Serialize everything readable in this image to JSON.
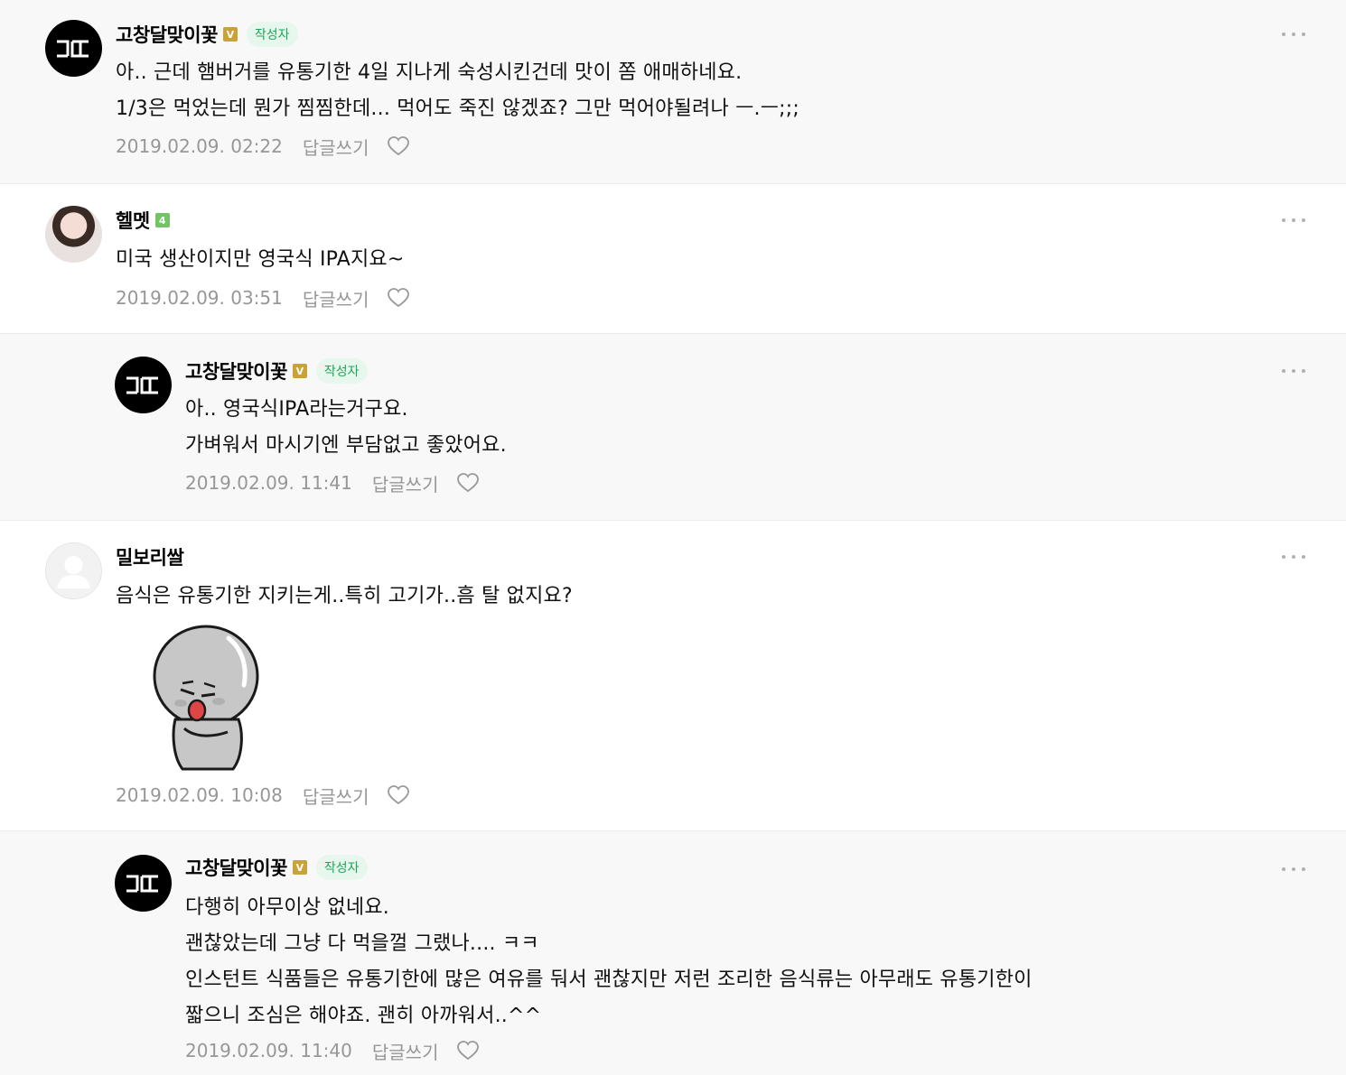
{
  "comments": [
    {
      "nickname": "고창달맞이꽃",
      "badge": "V",
      "author_tag": "작성자",
      "text": "아.. 근데 햄버거를 유통기한 4일 지나게 숙성시킨건데 맛이 쫌 애매하네요.\n1/3은 먹었는데 뭔가 찜찜한데... 먹어도 죽진 않겠죠? 그만 먹어야될려나 ㅡ.ㅡ;;;",
      "date": "2019.02.09. 02:22",
      "reply_label": "답글쓰기"
    },
    {
      "nickname": "헬멧",
      "badge": "4",
      "text": "미국 생산이지만 영국식 IPA지요~",
      "date": "2019.02.09. 03:51",
      "reply_label": "답글쓰기"
    },
    {
      "nickname": "고창달맞이꽃",
      "badge": "V",
      "author_tag": "작성자",
      "text": "아.. 영국식IPA라는거구요.\n가벼워서 마시기엔 부담없고 좋았어요.",
      "date": "2019.02.09. 11:41",
      "reply_label": "답글쓰기"
    },
    {
      "nickname": "밀보리쌀",
      "text": "음식은 유통기한 지키는게..특히 고기가..흠 탈 없지요?",
      "date": "2019.02.09. 10:08",
      "reply_label": "답글쓰기"
    },
    {
      "nickname": "고창달맞이꽃",
      "badge": "V",
      "author_tag": "작성자",
      "text": "다행히 아무이상 없네요.\n괜찮았는데 그냥 다 먹을껄 그랬나.... ㅋㅋ\n인스턴트 식품들은 유통기한에 많은 여유를 둬서 괜찮지만 저런 조리한 음식류는 아무래도 유통기한이\n짧으니 조심은 해야죠. 괜히 아까워서..^^",
      "date": "2019.02.09. 11:40",
      "reply_label": "답글쓰기"
    }
  ],
  "logo_text": "고달",
  "icons": {
    "like": "heart-outline-icon",
    "more": "more-dots-icon"
  },
  "colors": {
    "author_bg": "#f8f8f8",
    "author_tag_bg": "#e8f7ee",
    "author_tag_text": "#1fa55a",
    "badge_v": "#c9a33a",
    "badge_level": "#73c462",
    "meta_text": "#979797"
  }
}
